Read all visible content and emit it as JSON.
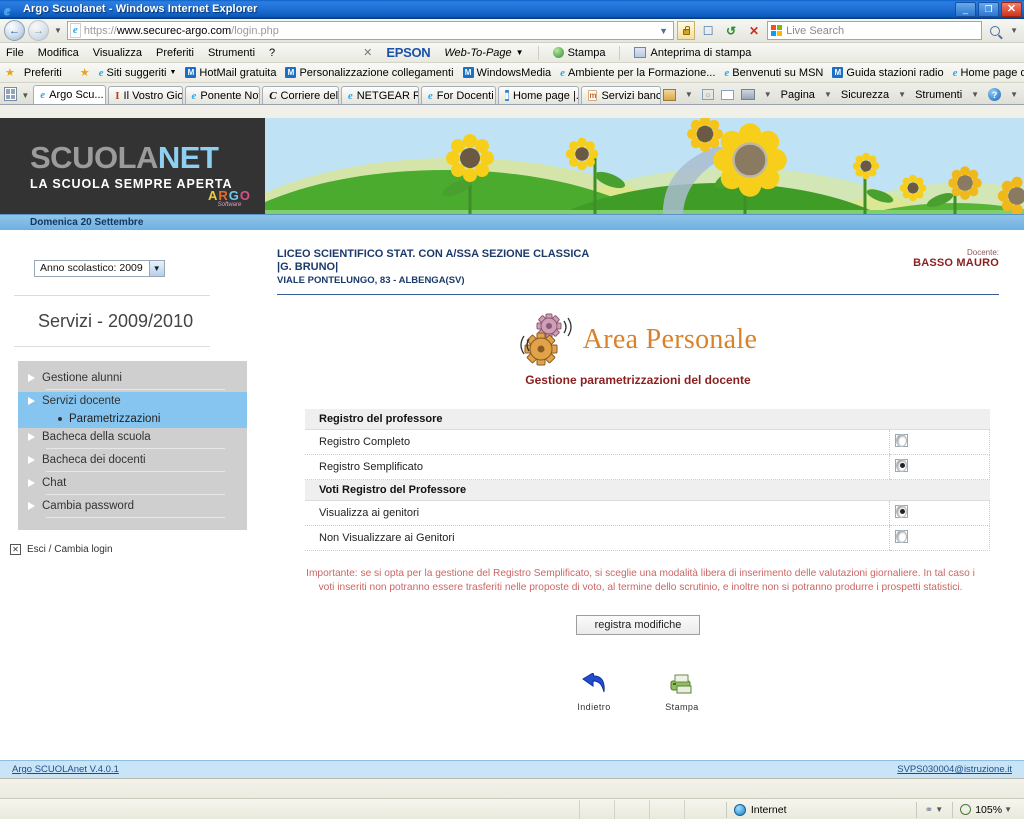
{
  "window": {
    "title": "Argo Scuolanet - Windows Internet Explorer",
    "app_icon": "ie-icon",
    "minimize_label": "_",
    "maximize_label": "❐",
    "close_label": "✕"
  },
  "nav": {
    "back_icon": "back-arrow-icon",
    "forward_icon": "forward-arrow-icon",
    "history_caret": "▼",
    "address_icon": "page-icon",
    "url_scheme": "https://",
    "url_host": "www.securec-argo.com",
    "url_path": "/login.php",
    "url_full": "https://www.securec-argo.com/login.php",
    "dropdown_caret": "▼",
    "lock_icon": "lock-icon",
    "compat_icon": "compatibility-view-icon",
    "refresh_icon": "refresh-icon",
    "stop_icon": "stop-icon",
    "search_placeholder": "Live Search",
    "search_value": "",
    "search_icon": "magnifier-icon",
    "search_caret": "▼"
  },
  "menubar": {
    "items": [
      "File",
      "Modifica",
      "Visualizza",
      "Preferiti",
      "Strumenti",
      "?"
    ],
    "epson": {
      "close_icon": "close-icon",
      "brand": "EPSON",
      "webtopage": "Web-To-Page",
      "caret": "▼",
      "print_label": "Stampa",
      "print_icon": "print-green-icon",
      "preview_label": "Anteprima di stampa",
      "preview_icon": "print-preview-icon"
    }
  },
  "favorites": {
    "star_icon": "star-icon",
    "label": "Preferiti",
    "add_icon": "add-favorite-icon",
    "items": [
      {
        "label": "Siti suggeriti",
        "icon": "ie-icon",
        "caret": "▼"
      },
      {
        "label": "HotMail gratuita",
        "icon": "msn-icon"
      },
      {
        "label": "Personalizzazione collegamenti",
        "icon": "msn-icon"
      },
      {
        "label": "WindowsMedia",
        "icon": "msn-icon"
      },
      {
        "label": "Ambiente per la Formazione...",
        "icon": "ie-icon"
      },
      {
        "label": "Benvenuti su MSN",
        "icon": "ie-icon"
      },
      {
        "label": "Guida stazioni radio",
        "icon": "msn-icon"
      },
      {
        "label": "Home page di Microsoft Win...",
        "icon": "ie-icon"
      }
    ],
    "overflow": "»"
  },
  "tabs": {
    "quicktabs_icon": "quick-tabs-icon",
    "quicktabs_caret": "▼",
    "items": [
      {
        "label": "Argo Scu...",
        "icon": "ie-icon",
        "active": true,
        "close": "✕"
      },
      {
        "label": "Il Vostro Gio...",
        "icon": "text-cursor-icon",
        "active": false
      },
      {
        "label": "Ponente Not...",
        "icon": "ie-icon",
        "active": false
      },
      {
        "label": "Corriere dell...",
        "icon": "corriere-icon",
        "active": false
      },
      {
        "label": "NETGEAR R...",
        "icon": "ie-icon",
        "active": false
      },
      {
        "label": "For Docenti ...",
        "icon": "ie-icon",
        "active": false
      },
      {
        "label": "Home page |...",
        "icon": "blue-page-icon",
        "active": false
      },
      {
        "label": "Servizi banc...",
        "icon": "bank-icon",
        "active": false
      }
    ],
    "commands": {
      "home_icon": "home-icon",
      "home_caret": "▼",
      "feeds_icon": "feeds-icon",
      "mail_icon": "mail-icon",
      "print_icon": "print-icon",
      "print_caret": "▼",
      "page": "Pagina",
      "page_caret": "▼",
      "security": "Sicurezza",
      "security_caret": "▼",
      "tools": "Strumenti",
      "tools_caret": "▼",
      "help_icon": "help-icon",
      "help_caret": "▼",
      "overflow": "»"
    }
  },
  "banner": {
    "logo_scuola": "SCUOLA",
    "logo_net": "NET",
    "tagline": "LA SCUOLA SEMPRE APERTA",
    "argo_brand": "ARGO",
    "argo_sub": "Software",
    "date": "Domenica 20 Settembre"
  },
  "sidebar": {
    "year_select": {
      "value": "Anno scolastico: 2009",
      "caret": "▼"
    },
    "section_title": "Servizi - 2009/2010",
    "menu": [
      {
        "label": "Gestione alunni",
        "selected": false
      },
      {
        "label": "Servizi docente",
        "selected": true,
        "sub": [
          {
            "label": "Parametrizzazioni"
          }
        ]
      },
      {
        "label": "Bacheca della scuola",
        "selected": false
      },
      {
        "label": "Bacheca dei docenti",
        "selected": false
      },
      {
        "label": "Chat",
        "selected": false
      },
      {
        "label": "Cambia password",
        "selected": false
      }
    ],
    "logout": {
      "icon": "exit-icon",
      "box": "✕",
      "label": "Esci / Cambia login"
    }
  },
  "main": {
    "school_line1": "LICEO SCIENTIFICO STAT. CON A/SSA SEZIONE CLASSICA",
    "school_line2": "|G. BRUNO|",
    "school_address": "VIALE PONTELUNGO, 83 - ALBENGA(SV)",
    "teacher_label": "Docente:",
    "teacher_name": "BASSO MAURO",
    "area_title": "Area Personale",
    "area_icon": "gears-icon",
    "area_subtitle": "Gestione parametrizzazioni del docente",
    "table": {
      "rows": [
        {
          "type": "group",
          "label": "Registro del professore"
        },
        {
          "type": "option",
          "label": "Registro Completo",
          "checked": false
        },
        {
          "type": "option",
          "label": "Registro Semplificato",
          "checked": true
        },
        {
          "type": "group",
          "label": "Voti Registro del Professore"
        },
        {
          "type": "option",
          "label": "Visualizza ai genitori",
          "checked": true
        },
        {
          "type": "option",
          "label": "Non Visualizzare ai Genitori",
          "checked": false
        }
      ]
    },
    "warning": "Importante: se si opta per la gestione del Registro Semplificato, si sceglie una modalità libera di inserimento delle valutazioni giornaliere. In tal caso i voti inseriti non potranno essere trasferiti nelle proposte di voto, al termine dello scrutinio, e inoltre non si potranno produrre i prospetti statistici.",
    "save_button": "registra modifiche",
    "footer_actions": [
      {
        "label": "Indietro",
        "icon": "back-arrow-blue-icon"
      },
      {
        "label": "Stampa",
        "icon": "printer-green-icon"
      }
    ]
  },
  "page_footer": {
    "version_link": "Argo SCUOLAnet V.4.0.1",
    "email_link": "SVPS030004@istruzione.it"
  },
  "statusbar": {
    "zone_icon": "internet-zone-icon",
    "zone_label": "Internet",
    "protected_icon": "protected-mode-icon",
    "protected_caret": "▼",
    "zoom_icon": "zoom-icon",
    "zoom_level": "105%",
    "zoom_caret": "▼"
  },
  "colors": {
    "titlebar_blue": "#1f6fd6",
    "brand_dark": "#333333",
    "accent_orange": "#d9822b",
    "warn_red": "#cc6666",
    "school_blue": "#1b3a6b",
    "teacher_red": "#8a1f1f",
    "selection_blue": "#86c5f0",
    "sidebar_gray": "#cfcfcf"
  }
}
